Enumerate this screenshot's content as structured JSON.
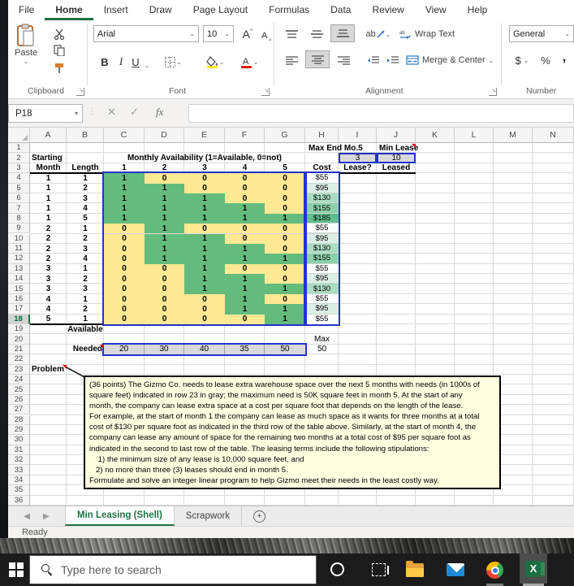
{
  "ribbon": {
    "tabs": [
      "File",
      "Home",
      "Insert",
      "Draw",
      "Page Layout",
      "Formulas",
      "Data",
      "Review",
      "View",
      "Help"
    ],
    "active_tab": "Home",
    "clipboard": {
      "label": "Clipboard",
      "paste": "Paste"
    },
    "font": {
      "label": "Font",
      "name": "Arial",
      "size": "10",
      "bold": "B",
      "italic": "I",
      "underline": "U",
      "grow": "A",
      "shrink": "A",
      "color_letter": "A"
    },
    "alignment": {
      "label": "Alignment",
      "wrap": "Wrap Text",
      "merge": "Merge & Center",
      "orientation": "ab"
    },
    "number": {
      "label": "Number",
      "format": "General",
      "currency": "$",
      "percent": "%",
      "comma": ","
    }
  },
  "formula_bar": {
    "name_box": "P18",
    "fx": "fx",
    "formula": ""
  },
  "sheet": {
    "col_headers": [
      "A",
      "B",
      "C",
      "D",
      "E",
      "F",
      "G",
      "H",
      "I",
      "J",
      "K",
      "L",
      "M",
      "N"
    ],
    "row_count": 36,
    "selected_row": 18,
    "labels": {
      "starting": "Starting",
      "avail_title": "Monthly Availability (1=Available, 0=not)",
      "month": "Month",
      "length": "Length",
      "cost": "Cost",
      "lease_q": "Lease?",
      "leased": "Leased",
      "max_end": "Max End Mo.5",
      "min_lease": "Min Lease",
      "available": "Available",
      "needed": "Needed",
      "max": "Max",
      "problem": "Problem"
    },
    "month_cols": [
      "1",
      "2",
      "3",
      "4",
      "5"
    ],
    "params": {
      "max_end_mo5": "3",
      "min_lease": "10"
    },
    "lease_rows": [
      {
        "month": "1",
        "length": "1",
        "avail": [
          1,
          0,
          0,
          0,
          0
        ],
        "cost": "$55"
      },
      {
        "month": "1",
        "length": "2",
        "avail": [
          1,
          1,
          0,
          0,
          0
        ],
        "cost": "$95"
      },
      {
        "month": "1",
        "length": "3",
        "avail": [
          1,
          1,
          1,
          0,
          0
        ],
        "cost": "$130"
      },
      {
        "month": "1",
        "length": "4",
        "avail": [
          1,
          1,
          1,
          1,
          0
        ],
        "cost": "$155"
      },
      {
        "month": "1",
        "length": "5",
        "avail": [
          1,
          1,
          1,
          1,
          1
        ],
        "cost": "$185"
      },
      {
        "month": "2",
        "length": "1",
        "avail": [
          0,
          1,
          0,
          0,
          0
        ],
        "cost": "$55"
      },
      {
        "month": "2",
        "length": "2",
        "avail": [
          0,
          1,
          1,
          0,
          0
        ],
        "cost": "$95"
      },
      {
        "month": "2",
        "length": "3",
        "avail": [
          0,
          1,
          1,
          1,
          0
        ],
        "cost": "$130"
      },
      {
        "month": "2",
        "length": "4",
        "avail": [
          0,
          1,
          1,
          1,
          1
        ],
        "cost": "$155"
      },
      {
        "month": "3",
        "length": "1",
        "avail": [
          0,
          0,
          1,
          0,
          0
        ],
        "cost": "$55"
      },
      {
        "month": "3",
        "length": "2",
        "avail": [
          0,
          0,
          1,
          1,
          0
        ],
        "cost": "$95"
      },
      {
        "month": "3",
        "length": "3",
        "avail": [
          0,
          0,
          1,
          1,
          1
        ],
        "cost": "$130"
      },
      {
        "month": "4",
        "length": "1",
        "avail": [
          0,
          0,
          0,
          1,
          0
        ],
        "cost": "$55"
      },
      {
        "month": "4",
        "length": "2",
        "avail": [
          0,
          0,
          0,
          1,
          1
        ],
        "cost": "$95"
      },
      {
        "month": "5",
        "length": "1",
        "avail": [
          0,
          0,
          0,
          0,
          1
        ],
        "cost": "$55"
      }
    ],
    "needed_values": [
      "20",
      "30",
      "40",
      "35",
      "50"
    ],
    "max_needed": "50",
    "colors": {
      "accent_green": "#217346",
      "avail_yes": "#63bc7d",
      "avail_no": "#ffe994",
      "range_border": "#2233cc",
      "input_gray": "#d9d9d9",
      "comment_bg": "#ffffe1",
      "cost_scale": {
        "$55": "#fbfdfc",
        "$95": "#dcefe4",
        "$130": "#acdcc2",
        "$155": "#8dd0ab",
        "$185": "#60be8c"
      }
    }
  },
  "comment_box": {
    "lines": [
      "(36 points) The Gizmo Co. needs to lease extra warehouse space over the next 5 months with needs (in 1000s of",
      "square feet) indicated in row 23 in gray; the maximum need is 50K square feet in month 5. At the start of any",
      "month, the company can lease extra space at a cost per square foot that depends on the length of the lease.",
      "For example, at the start of month 1 the company can lease as much space as it wants for three months at a total",
      "cost of $130 per square foot as indicated in the third row of the table above. Similarly, at the start of month 4, the",
      "company can lease any amount of space for the remaining two months at a total cost of $95 per square foot as",
      "indicated in the second to last row of the table. The leasing terms include the following stipulations:",
      "    1) the minimum size of any lease is 10,000 square feet, and",
      "   2) no more than three (3) leases should end in month 5.",
      "Formulate and solve an integer linear program to help Gizmo meet their needs in the least costly way."
    ]
  },
  "tabs_bar": {
    "sheets": [
      {
        "name": "Min Leasing (Shell)",
        "active": true
      },
      {
        "name": "Scrapwork",
        "active": false
      }
    ]
  },
  "status_bar": {
    "text": "Ready"
  },
  "taskbar": {
    "search_placeholder": "Type here to search"
  }
}
